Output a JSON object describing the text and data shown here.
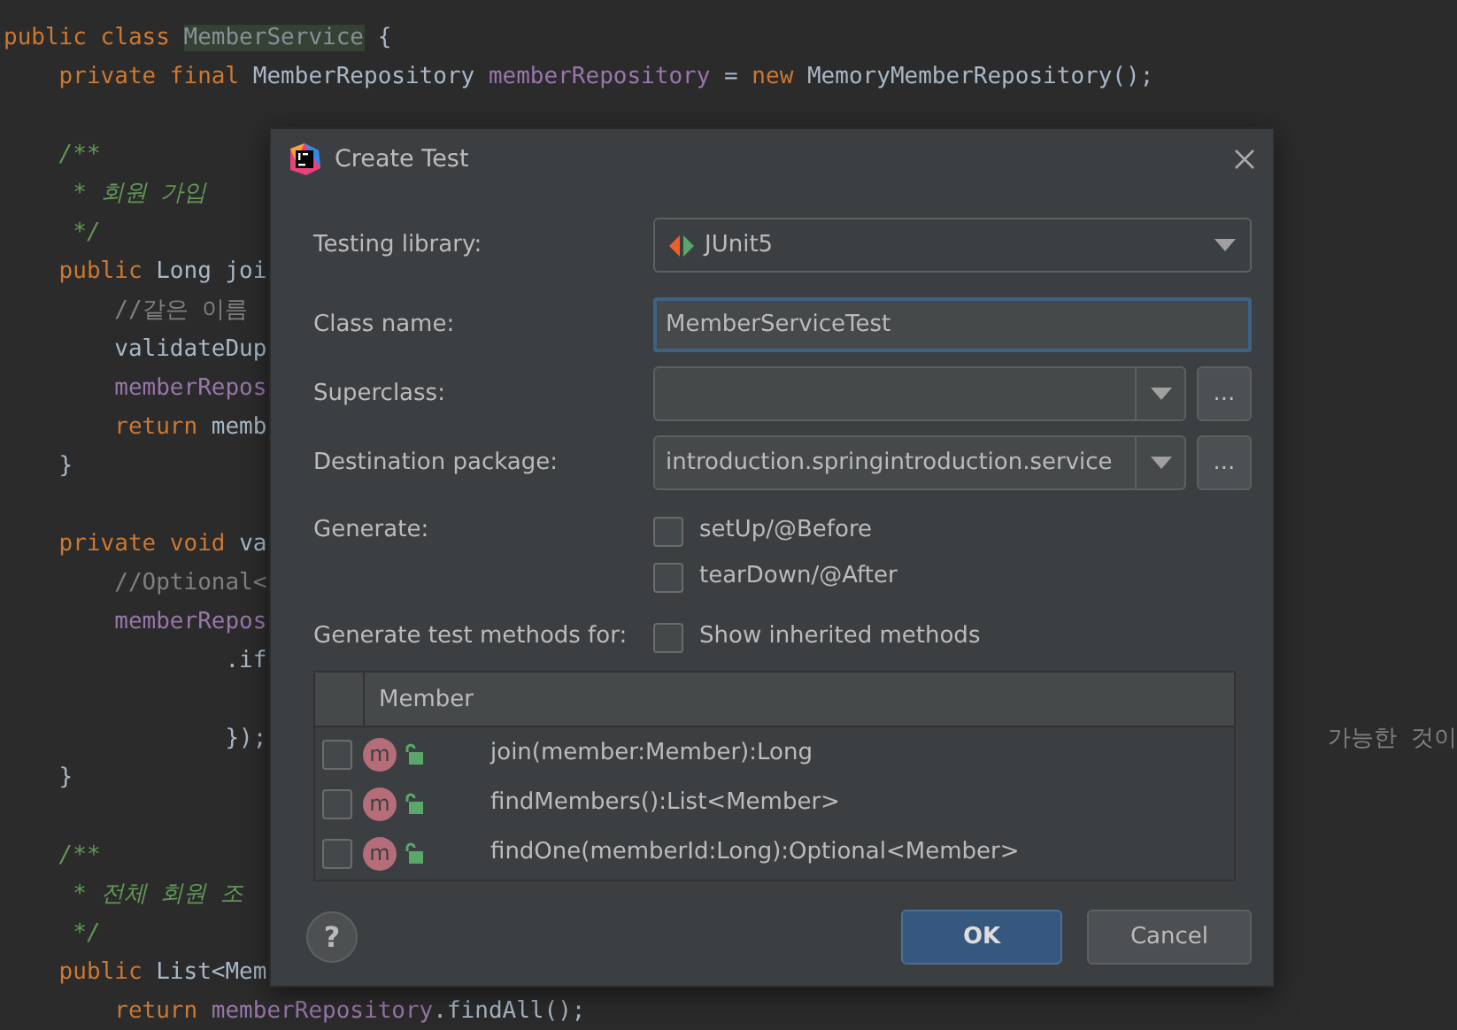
{
  "editor": {
    "lines": [
      {
        "tokens": [
          {
            "text": "public class ",
            "kind": "keyword"
          },
          {
            "text": "MemberService",
            "kind": "highlight"
          },
          {
            "text": " {",
            "kind": "plain"
          }
        ]
      },
      {
        "tokens": [
          {
            "text": "    private final ",
            "kind": "keyword"
          },
          {
            "text": "MemberRepository ",
            "kind": "plain"
          },
          {
            "text": "memberRepository",
            "kind": "field"
          },
          {
            "text": " = ",
            "kind": "plain"
          },
          {
            "text": "new ",
            "kind": "keyword"
          },
          {
            "text": "MemoryMemberRepository();",
            "kind": "plain"
          }
        ]
      },
      {
        "blank_before": true,
        "tokens": [
          {
            "text": "    /**",
            "kind": "doc"
          }
        ]
      },
      {
        "tokens": [
          {
            "text": "     * 회원 가입",
            "kind": "doc"
          }
        ]
      },
      {
        "tokens": [
          {
            "text": "     */",
            "kind": "doc"
          }
        ]
      },
      {
        "tokens": [
          {
            "text": "    public ",
            "kind": "keyword"
          },
          {
            "text": "Long joi",
            "kind": "plain"
          }
        ]
      },
      {
        "tokens": [
          {
            "text": "        //같은 이름",
            "kind": "comment"
          }
        ]
      },
      {
        "tokens": [
          {
            "text": "        validateDup",
            "kind": "plain"
          }
        ]
      },
      {
        "tokens": [
          {
            "text": "        memberRepos",
            "kind": "field"
          }
        ]
      },
      {
        "tokens": [
          {
            "text": "        return ",
            "kind": "keyword"
          },
          {
            "text": "memb",
            "kind": "plain"
          }
        ]
      },
      {
        "tokens": [
          {
            "text": "    }",
            "kind": "plain"
          }
        ]
      },
      {
        "blank_before": true,
        "tokens": [
          {
            "text": "    private void ",
            "kind": "keyword"
          },
          {
            "text": "va",
            "kind": "plain"
          }
        ]
      },
      {
        "tokens": [
          {
            "text": "        //Optional<",
            "kind": "comment"
          }
        ]
      },
      {
        "tokens": [
          {
            "text": "        memberRepos",
            "kind": "field"
          }
        ]
      },
      {
        "tokens": [
          {
            "text": "                .if",
            "kind": "plain"
          }
        ]
      },
      {
        "blank_before": true,
        "tokens": [
          {
            "text": "                });",
            "kind": "plain"
          }
        ],
        "tail": "가능한 것이"
      },
      {
        "tokens": [
          {
            "text": "    }",
            "kind": "plain"
          }
        ]
      },
      {
        "blank_before": true,
        "tokens": [
          {
            "text": "    /**",
            "kind": "doc"
          }
        ]
      },
      {
        "tokens": [
          {
            "text": "     * 전체 회원 조",
            "kind": "doc"
          }
        ]
      },
      {
        "tokens": [
          {
            "text": "     */",
            "kind": "doc"
          }
        ]
      },
      {
        "tokens": [
          {
            "text": "    public ",
            "kind": "keyword"
          },
          {
            "text": "List<Mem",
            "kind": "plain"
          }
        ]
      },
      {
        "tokens": [
          {
            "text": "        return ",
            "kind": "keyword"
          },
          {
            "text": "memberRepository",
            "kind": "field"
          },
          {
            "text": ".findAll();",
            "kind": "plain"
          }
        ]
      }
    ]
  },
  "dialog": {
    "title": "Create Test",
    "testing_library": {
      "label": "Testing library:",
      "value": "JUnit5"
    },
    "class_name": {
      "label": "Class name:",
      "value": "MemberServiceTest",
      "focused": true
    },
    "superclass": {
      "label": "Superclass:",
      "browse": "..."
    },
    "destination_package": {
      "label": "Destination package:",
      "value": "introduction.springintroduction.service",
      "browse": "..."
    },
    "generate": {
      "label": "Generate:",
      "options": [
        {
          "label": "setUp/@Before",
          "checked": false
        },
        {
          "label": "tearDown/@After",
          "checked": false
        }
      ]
    },
    "test_methods": {
      "label": "Generate test methods for:",
      "show_inherited": {
        "label": "Show inherited methods",
        "checked": false
      },
      "column": "Member",
      "rows": [
        {
          "badge": "m",
          "signature": "join(member:Member):Long",
          "checked": false
        },
        {
          "badge": "m",
          "signature": "findMembers():List<Member>",
          "checked": false
        },
        {
          "badge": "m",
          "signature": "findOne(memberId:Long):Optional<Member>",
          "checked": false
        }
      ]
    },
    "help": "?",
    "buttons": [
      {
        "label": "OK",
        "default": true
      },
      {
        "label": "Cancel",
        "default": false
      }
    ]
  }
}
